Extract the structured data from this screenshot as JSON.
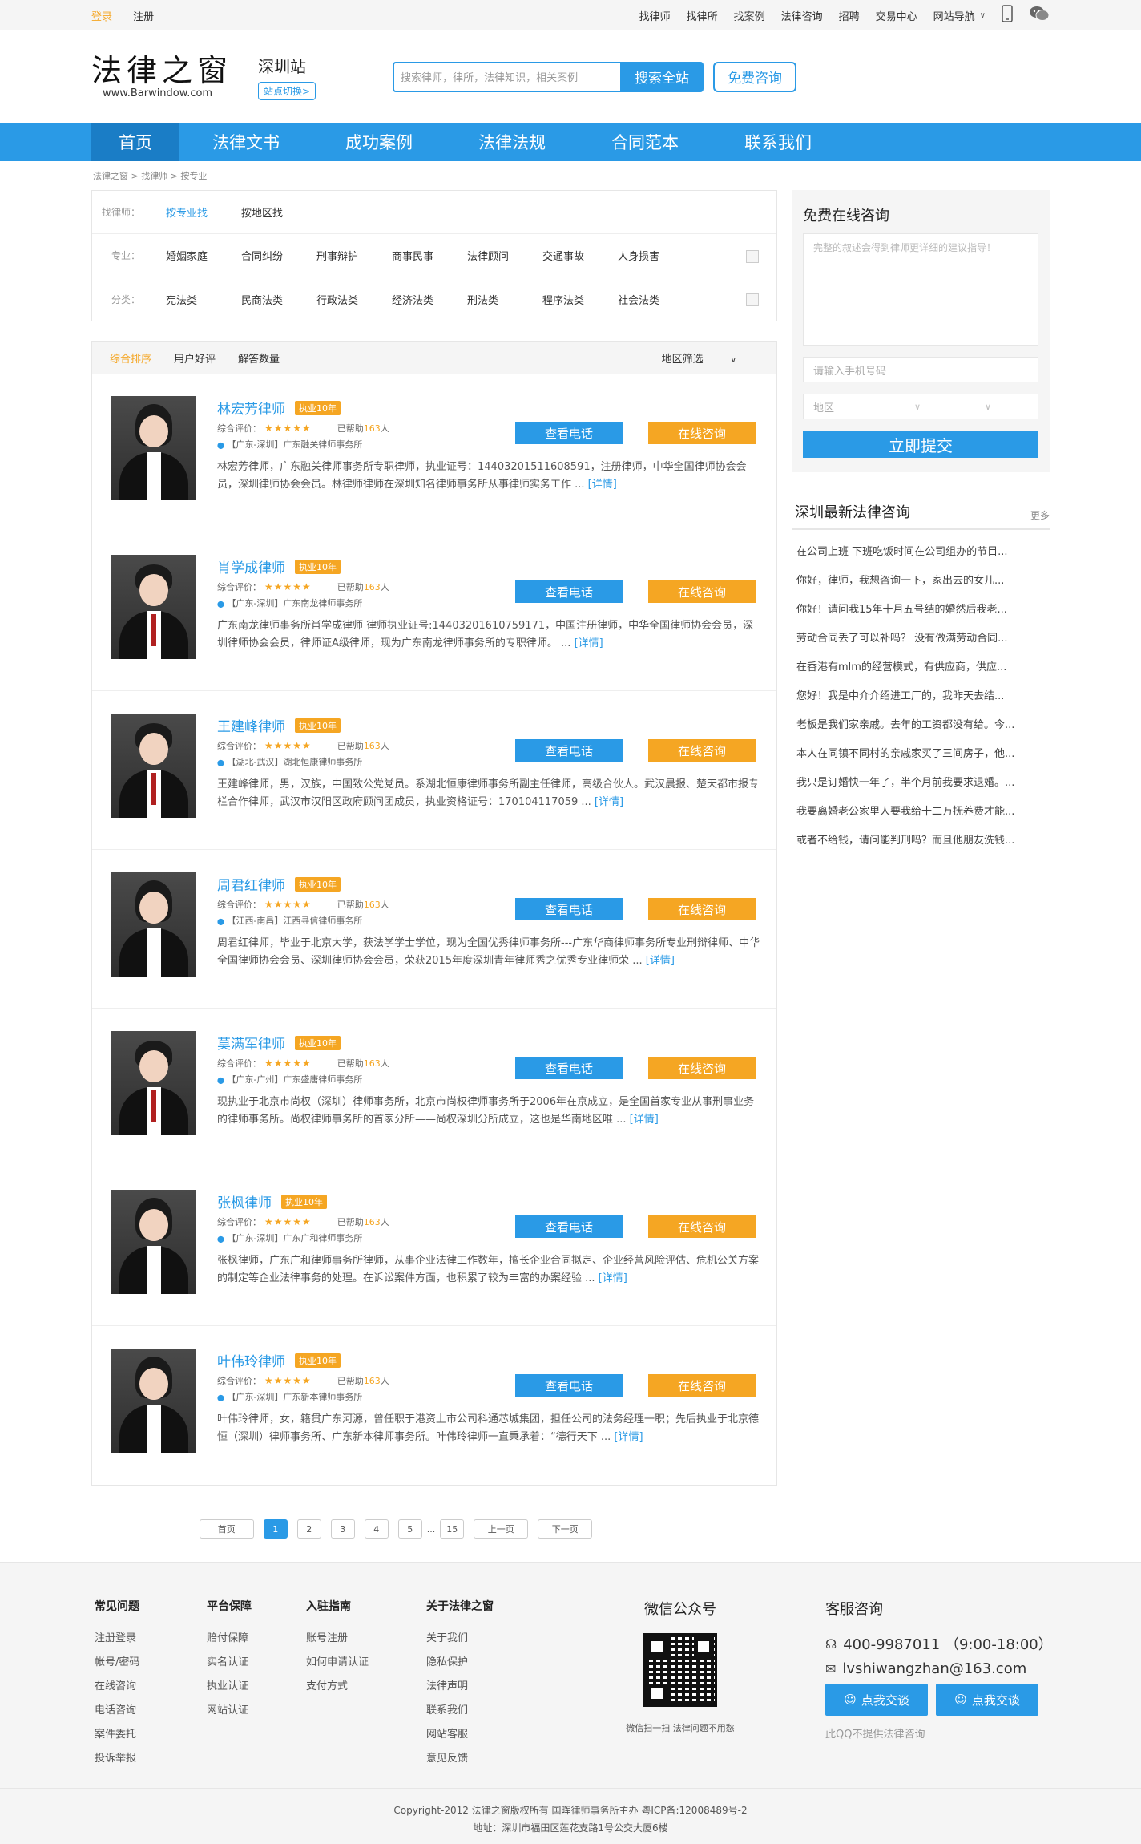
{
  "topbar": {
    "login": "登录",
    "register": "注册",
    "links": [
      "找律师",
      "找律所",
      "找案例",
      "法律咨询",
      "招聘",
      "交易中心",
      "网站导航"
    ]
  },
  "header": {
    "logo_cn": "法律之窗",
    "logo_en": "www.Barwindow.com",
    "station": "深圳站",
    "station_switch": "站点切换>",
    "search_placeholder": "搜索律师，律所，法律知识，相关案例",
    "search_button": "搜索全站",
    "consult_button": "免费咨询"
  },
  "nav": [
    "首页",
    "法律文书",
    "成功案例",
    "法律法规",
    "合同范本",
    "联系我们"
  ],
  "breadcrumb": "法律之窗 > 找律师 > 按专业",
  "filter": {
    "find_label": "找律师：",
    "find_options": [
      "按专业找",
      "按地区找"
    ],
    "major_label": "专业：",
    "majors": [
      "婚姻家庭",
      "合同纠纷",
      "刑事辩护",
      "商事民事",
      "法律顾问",
      "交通事故",
      "人身损害"
    ],
    "category_label": "分类：",
    "categories": [
      "宪法类",
      "民商法类",
      "行政法类",
      "经济法类",
      "刑法类",
      "程序法类",
      "社会法类"
    ]
  },
  "sort": {
    "options": [
      "综合排序",
      "用户好评",
      "解答数量"
    ],
    "region": "地区筛选"
  },
  "lawyers": [
    {
      "name": "林宏芳律师",
      "badge": "执业10年",
      "rating_label": "综合评价：",
      "stars": "★★★★★",
      "help_pre": "已帮助",
      "help_num": "163",
      "help_post": "人",
      "location": "【广东-深圳】广东融关律师事务所",
      "desc": "林宏芳律师，广东融关律师事务所专职律师，执业证号：14403201511608591，注册律师，中华全国律师协会会员，深圳律师协会会员。林律师律师在深圳知名律师事务所从事律师实务工作 ... ",
      "more": "[详情]",
      "phone_btn": "查看电话",
      "consult_btn": "在线咨询"
    },
    {
      "name": "肖学成律师",
      "badge": "执业10年",
      "rating_label": "综合评价：",
      "stars": "★★★★★",
      "help_pre": "已帮助",
      "help_num": "163",
      "help_post": "人",
      "location": "【广东-深圳】广东南龙律师事务所",
      "desc": "广东南龙律师事务所肖学成律师 律师执业证号:14403201610759171，中国注册律师，中华全国律师协会会员，深圳律师协会会员，律师证A级律师，现为广东南龙律师事务所的专职律师。 ... ",
      "more": "[详情]",
      "phone_btn": "查看电话",
      "consult_btn": "在线咨询"
    },
    {
      "name": "王建峰律师",
      "badge": "执业10年",
      "rating_label": "综合评价：",
      "stars": "★★★★★",
      "help_pre": "已帮助",
      "help_num": "163",
      "help_post": "人",
      "location": "【湖北-武汉】湖北恒康律师事务所",
      "desc": "王建峰律师，男，汉族，中国致公党党员。系湖北恒康律师事务所副主任律师，高级合伙人。武汉晨报、楚天都市报专栏合作律师，武汉市汉阳区政府顾问团成员，执业资格证号：170104117059 ... ",
      "more": "[详情]",
      "phone_btn": "查看电话",
      "consult_btn": "在线咨询"
    },
    {
      "name": "周君红律师",
      "badge": "执业10年",
      "rating_label": "综合评价：",
      "stars": "★★★★★",
      "help_pre": "已帮助",
      "help_num": "163",
      "help_post": "人",
      "location": "【江西-南昌】江西寻信律师事务所",
      "desc": "周君红律师，毕业于北京大学，获法学学士学位，现为全国优秀律师事务所---广东华商律师事务所专业刑辩律师、中华全国律师协会会员、深圳律师协会会员，荣获2015年度深圳青年律师秀之优秀专业律师荣 ... ",
      "more": "[详情]",
      "phone_btn": "查看电话",
      "consult_btn": "在线咨询"
    },
    {
      "name": "莫满军律师",
      "badge": "执业10年",
      "rating_label": "综合评价：",
      "stars": "★★★★★",
      "help_pre": "已帮助",
      "help_num": "163",
      "help_post": "人",
      "location": "【广东-广州】广东盛唐律师事务所",
      "desc": "现执业于北京市尚权（深圳）律师事务所，北京市尚权律师事务所于2006年在京成立，是全国首家专业从事刑事业务的律师事务所。尚权律师事务所的首家分所——尚权深圳分所成立，这也是华南地区唯 ... ",
      "more": "[详情]",
      "phone_btn": "查看电话",
      "consult_btn": "在线咨询"
    },
    {
      "name": "张枫律师",
      "badge": "执业10年",
      "rating_label": "综合评价：",
      "stars": "★★★★★",
      "help_pre": "已帮助",
      "help_num": "163",
      "help_post": "人",
      "location": "【广东-深圳】广东广和律师事务所",
      "desc": "张枫律师，广东广和律师事务所律师，从事企业法律工作数年，擅长企业合同拟定、企业经营风险评估、危机公关方案的制定等企业法律事务的处理。在诉讼案件方面，也积累了较为丰富的办案经验 ... ",
      "more": "[详情]",
      "phone_btn": "查看电话",
      "consult_btn": "在线咨询"
    },
    {
      "name": "叶伟玲律师",
      "badge": "执业10年",
      "rating_label": "综合评价：",
      "stars": "★★★★★",
      "help_pre": "已帮助",
      "help_num": "163",
      "help_post": "人",
      "location": "【广东-深圳】广东新本律师事务所",
      "desc": "叶伟玲律师，女，籍贯广东河源，曾任职于港资上市公司科通芯城集团，担任公司的法务经理一职；先后执业于北京德恒（深圳）律师事务所、广东新本律师事务所。叶伟玲律师一直秉承着：“德行天下 ... ",
      "more": "[详情]",
      "phone_btn": "查看电话",
      "consult_btn": "在线咨询"
    }
  ],
  "pager": {
    "first": "首页",
    "pages": [
      "1",
      "2",
      "3",
      "4",
      "5"
    ],
    "dots": "...",
    "last": "15",
    "prev": "上一页",
    "next": "下一页",
    "current": "1"
  },
  "consult_form": {
    "title": "免费在线咨询",
    "textarea_placeholder": "完整的叙述会得到律师更详细的建议指导！",
    "phone_placeholder": "请输入手机号码",
    "region_placeholder": "地区",
    "submit": "立即提交"
  },
  "qa": {
    "title": "深圳最新法律咨询",
    "more": "更多",
    "items": [
      "在公司上班 下班吃饭时间在公司组办的节目...",
      "你好，律师，我想咨询一下，家出去的女儿...",
      "你好！请问我15年十月五号结的婚然后我老...",
      "劳动合同丢了可以补吗？ 没有做满劳动合同...",
      "在香港有mlm的经营模式，有供应商，供应...",
      "您好！我是中介介绍进工厂的，我昨天去结...",
      "老板是我们家亲戚。去年的工资都没有给。今...",
      "本人在同镇不同村的亲戚家买了三间房子，他...",
      "我只是订婚快一年了，半个月前我要求退婚。...",
      "我要离婚老公家里人要我给十二万抚养费才能...",
      "或者不给钱，请问能判刑吗？而且他朋友洗钱..."
    ]
  },
  "footer": {
    "cols": [
      {
        "title": "常见问题",
        "items": [
          "注册登录",
          "帐号/密码",
          "在线咨询",
          "电话咨询",
          "案件委托",
          "投诉举报"
        ]
      },
      {
        "title": "平台保障",
        "items": [
          "赔付保障",
          "实名认证",
          "执业认证",
          "网站认证"
        ]
      },
      {
        "title": "入驻指南",
        "items": [
          "账号注册",
          "如何申请认证",
          "支付方式"
        ]
      },
      {
        "title": "关于法律之窗",
        "items": [
          "关于我们",
          "隐私保护",
          "法律声明",
          "联系我们",
          "网站客服",
          "意见反馈"
        ]
      }
    ],
    "wechat_title": "微信公众号",
    "wechat_caption": "微信扫一扫   法律问题不用愁",
    "service_title": "客服咨询",
    "phone": "400-9987011 （9:00-18:00）",
    "email": "lvshiwangzhan@163.com",
    "qq_buttons": [
      "点我交谈",
      "点我交谈"
    ],
    "qq_note": "此QQ不提供法律咨询",
    "copyright": "Copyright-2012 法律之窗版权所有   国晖律师事务所主办  粤ICP备:12008489号-2",
    "address": "地址：深圳市福田区莲花支路1号公交大厦6楼"
  },
  "colors": {
    "primary": "#2a9ae6",
    "accent": "#f5a623"
  }
}
